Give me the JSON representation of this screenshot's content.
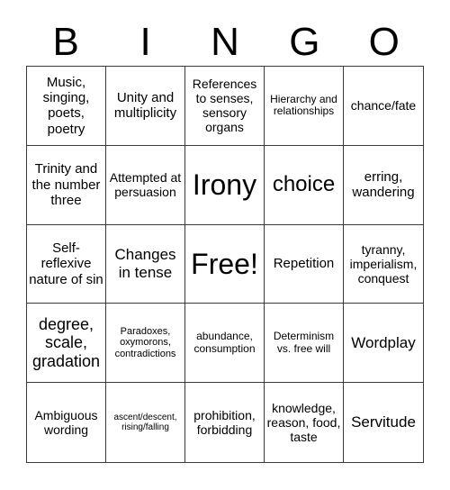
{
  "header": {
    "letters": [
      "B",
      "I",
      "N",
      "G",
      "O"
    ]
  },
  "cells": [
    "Music, singing, poets, poetry",
    "Unity and multiplicity",
    "References to senses, sensory organs",
    "Hierarchy and relationships",
    "chance/fate",
    "Trinity and the number three",
    "Attempted at persuasion",
    "Irony",
    "choice",
    "erring, wandering",
    "Self-reflexive nature of sin",
    "Changes in tense",
    "Free!",
    "Repetition",
    "tyranny, imperialism, conquest",
    "degree, scale, gradation",
    "Paradoxes, oxymorons, contradictions",
    "abundance, consumption",
    "Determinism vs. free will",
    "Wordplay",
    "Ambiguous wording",
    "ascent/descent, rising/falling",
    "prohibition, forbidding",
    "knowledge, reason, food, taste",
    "Servitude"
  ]
}
